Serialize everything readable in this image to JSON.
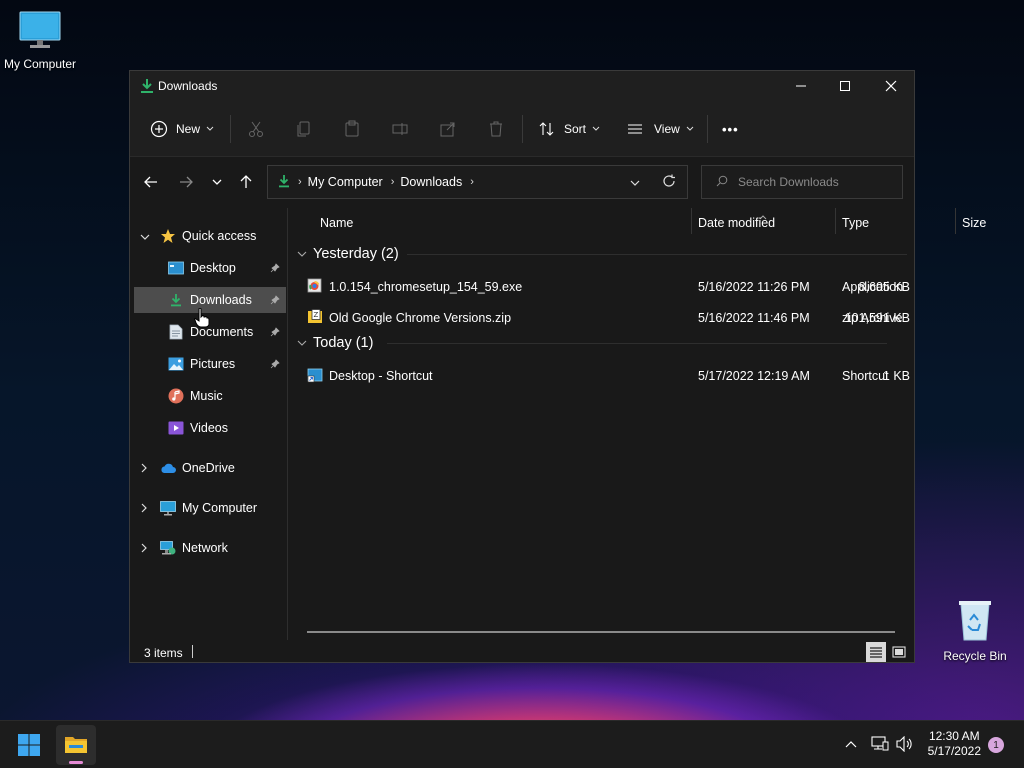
{
  "desktop": {
    "icons": [
      {
        "label": "My Computer",
        "icon": "monitor-icon"
      },
      {
        "label": "Recycle Bin",
        "icon": "recycle-bin-icon"
      }
    ]
  },
  "window": {
    "title": "Downloads",
    "toolbar": {
      "new_label": "New",
      "sort_label": "Sort",
      "view_label": "View",
      "more_label": "•••"
    },
    "address": {
      "crumbs": [
        "My Computer",
        "Downloads"
      ]
    },
    "search": {
      "placeholder": "Search Downloads"
    },
    "sidebar": {
      "quick_access": "Quick access",
      "pinned": [
        {
          "label": "Desktop",
          "icon": "desktop-folder-icon",
          "pinned": true
        },
        {
          "label": "Downloads",
          "icon": "download-icon",
          "pinned": true,
          "selected": true
        },
        {
          "label": "Documents",
          "icon": "documents-icon",
          "pinned": true
        },
        {
          "label": "Pictures",
          "icon": "pictures-icon",
          "pinned": true
        },
        {
          "label": "Music",
          "icon": "music-icon",
          "pinned": false
        },
        {
          "label": "Videos",
          "icon": "videos-icon",
          "pinned": false
        }
      ],
      "roots": [
        {
          "label": "OneDrive",
          "icon": "cloud-icon"
        },
        {
          "label": "My Computer",
          "icon": "monitor-icon"
        },
        {
          "label": "Network",
          "icon": "network-icon"
        }
      ]
    },
    "columns": [
      "Name",
      "Date modified",
      "Type",
      "Size"
    ],
    "groups": [
      {
        "label": "Yesterday (2)",
        "files": [
          {
            "name": "1.0.154_chromesetup_154_59.exe",
            "date": "5/16/2022 11:26 PM",
            "type": "Application",
            "size": "8,605 KB",
            "icon": "exe-icon"
          },
          {
            "name": "Old Google Chrome Versions.zip",
            "date": "5/16/2022 11:46 PM",
            "type": "zip Archive",
            "size": "101,591 KB",
            "icon": "zip-icon"
          }
        ]
      },
      {
        "label": "Today (1)",
        "files": [
          {
            "name": "Desktop - Shortcut",
            "date": "5/17/2022 12:19 AM",
            "type": "Shortcut",
            "size": "1 KB",
            "icon": "shortcut-icon"
          }
        ]
      }
    ],
    "status": {
      "items": "3 items"
    }
  },
  "taskbar": {
    "time": "12:30 AM",
    "date": "5/17/2022",
    "notification_count": "1"
  },
  "colors": {
    "accent_green": "#2fb36a",
    "folder_yellow": "#f4c431",
    "star_yellow": "#f6c443",
    "selection": "#4d4d4d"
  }
}
